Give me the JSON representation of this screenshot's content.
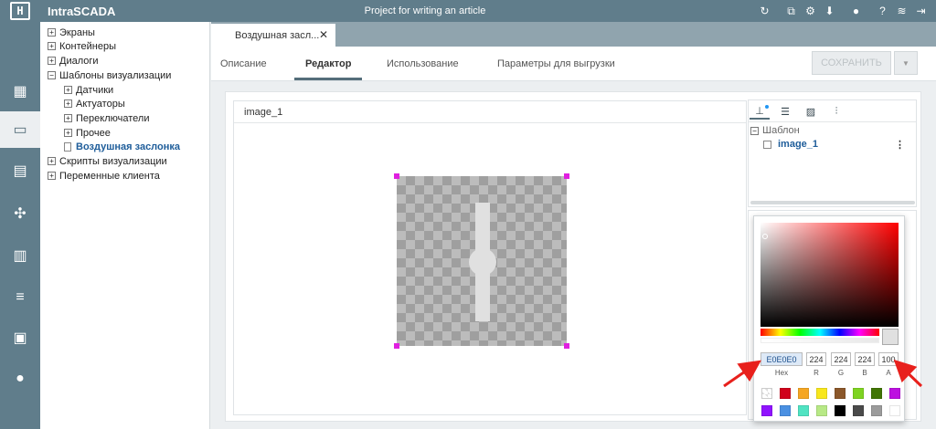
{
  "header": {
    "app_name": "IntraSCADA",
    "logo_text": "H",
    "project_title": "Project for writing an article",
    "icons": [
      "refresh-icon",
      "export-icon",
      "gear-icon",
      "download-icon",
      "bug-icon",
      "help-icon",
      "wifi-icon",
      "logout-icon"
    ]
  },
  "rail": {
    "items": [
      "device-icon",
      "monitor-icon",
      "document-icon",
      "puzzle-icon",
      "chart-icon",
      "database-icon",
      "printer-icon",
      "user-icon"
    ],
    "active_index": 1
  },
  "tree": {
    "items": [
      {
        "label": "Экраны",
        "expander": "+"
      },
      {
        "label": "Контейнеры",
        "expander": "+"
      },
      {
        "label": "Диалоги",
        "expander": "+"
      },
      {
        "label": "Шаблоны визуализации",
        "expander": "−"
      },
      {
        "label": "Датчики",
        "expander": "+"
      },
      {
        "label": "Актуаторы",
        "expander": "+"
      },
      {
        "label": "Переключатели",
        "expander": "+"
      },
      {
        "label": "Прочее",
        "expander": "+"
      },
      {
        "label": "Воздушная заслонка",
        "expander": ""
      },
      {
        "label": "Скрипты визуализации",
        "expander": "+"
      },
      {
        "label": "Переменные клиента",
        "expander": "+"
      }
    ]
  },
  "doc_tab": {
    "label": "Воздушная засл...",
    "close": "✕"
  },
  "subtabs": {
    "items": [
      "Описание",
      "Редактор",
      "Использование",
      "Параметры для выгрузки"
    ],
    "active_index": 1,
    "save_label": "СОХРАНИТЬ",
    "dropdown_glyph": "▼"
  },
  "canvas": {
    "title": "image_1"
  },
  "inspector": {
    "section_expander": "−",
    "section_label": "Шаблон",
    "item_label": "image_1",
    "menu_glyph": "⋮"
  },
  "color_picker": {
    "hex_value": "E0E0E0",
    "r": "224",
    "g": "224",
    "b": "224",
    "a": "100",
    "labels": {
      "hex": "Hex",
      "r": "R",
      "g": "G",
      "b": "B",
      "a": "A"
    },
    "preview_color": "#e0e0e0",
    "swatches": [
      "none",
      "#d0021b",
      "#f5a623",
      "#f8e71c",
      "#8b572a",
      "#7ed321",
      "#417505",
      "#bd10e0",
      "#9013fe",
      "#4a90e2",
      "#50e3c2",
      "#b8e986",
      "#000000",
      "#4a4a4a",
      "#9b9b9b",
      "#ffffff"
    ]
  },
  "colors": {
    "accent": "#607d8b",
    "arrow": "#e8201c",
    "selected_text": "#1e5d9a"
  }
}
